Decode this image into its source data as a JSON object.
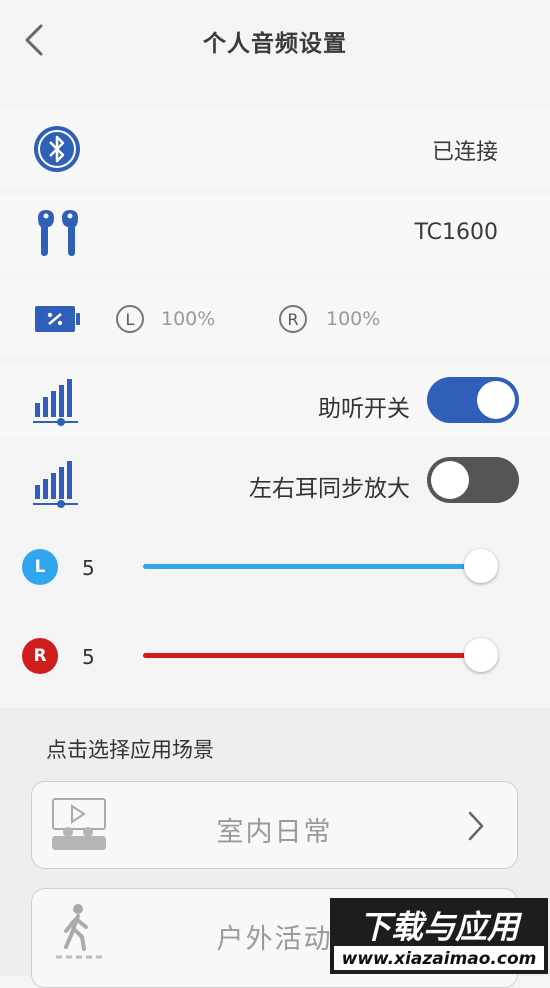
{
  "header": {
    "title": "个人音频设置"
  },
  "device": {
    "bluetooth_status": "已连接",
    "model": "TC1600",
    "battery": {
      "left_label": "L",
      "left_value": "100%",
      "right_label": "R",
      "right_value": "100%"
    }
  },
  "settings": {
    "hearing_aid_label": "助听开关",
    "hearing_aid_on": true,
    "sync_label": "左右耳同步放大",
    "sync_on": false
  },
  "sliders": {
    "left": {
      "badge": "L",
      "value": "5",
      "level": 1.0,
      "color": "#2fa6ee"
    },
    "right": {
      "badge": "R",
      "value": "5",
      "level": 1.0,
      "color": "#cf1d1d"
    }
  },
  "scenes": {
    "section_label": "点击选择应用场景",
    "items": [
      {
        "label": "室内日常"
      },
      {
        "label": "户外活动"
      }
    ]
  },
  "watermark": {
    "text_main": "下载与应用",
    "text_url": "www.xiazaimao.com"
  },
  "colors": {
    "accent": "#2f5fb8",
    "toggle_off": "#555555"
  }
}
